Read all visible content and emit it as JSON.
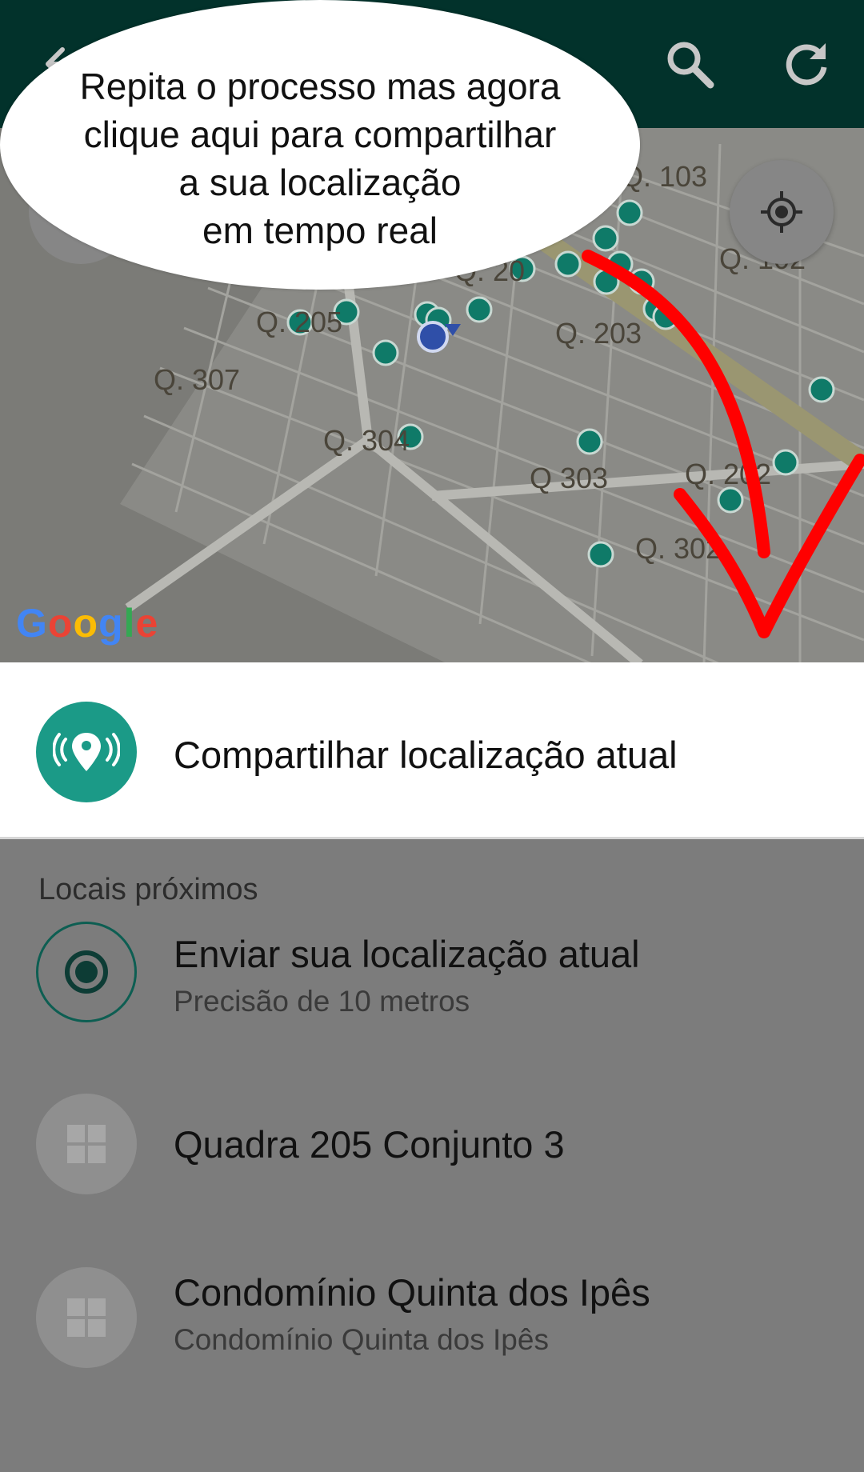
{
  "toolbar": {
    "back_icon": "arrow-back-icon",
    "search_icon": "search-icon",
    "refresh_icon": "refresh-icon"
  },
  "map": {
    "labels": [
      "Q. 103",
      "Q. 102",
      "Q. 205",
      "Q. 203",
      "Q. 307",
      "Q. 304",
      "Q 303",
      "Q. 202",
      "Q. 302",
      "Q. 20"
    ],
    "google_logo": [
      "G",
      "o",
      "o",
      "g",
      "l",
      "e"
    ],
    "google_colors": [
      "#4285F4",
      "#EA4335",
      "#FBBC05",
      "#4285F4",
      "#34A853",
      "#EA4335"
    ],
    "locate_icon": "my-location-icon",
    "pin_color": "#0f7a68",
    "user_dot_color": "#2f4fa8"
  },
  "share": {
    "label": "Compartilhar localização atual",
    "icon": "live-location-icon",
    "accent": "#1b9a87"
  },
  "nearby": {
    "title": "Locais próximos",
    "items": [
      {
        "title": "Enviar sua localização atual",
        "subtitle": "Precisão de 10 metros",
        "icon": "current-location-icon"
      },
      {
        "title": "Quadra 205 Conjunto 3",
        "subtitle": "",
        "icon": "place-icon"
      },
      {
        "title": "Condomínio Quinta dos Ipês",
        "subtitle": "Condomínio Quinta dos Ipês",
        "icon": "place-icon"
      }
    ]
  },
  "overlay": {
    "bubble_text": "Repita o processo mas agora\nclique aqui para compartilhar\na sua localização\nem tempo real",
    "arrow_color": "#ff0000"
  }
}
